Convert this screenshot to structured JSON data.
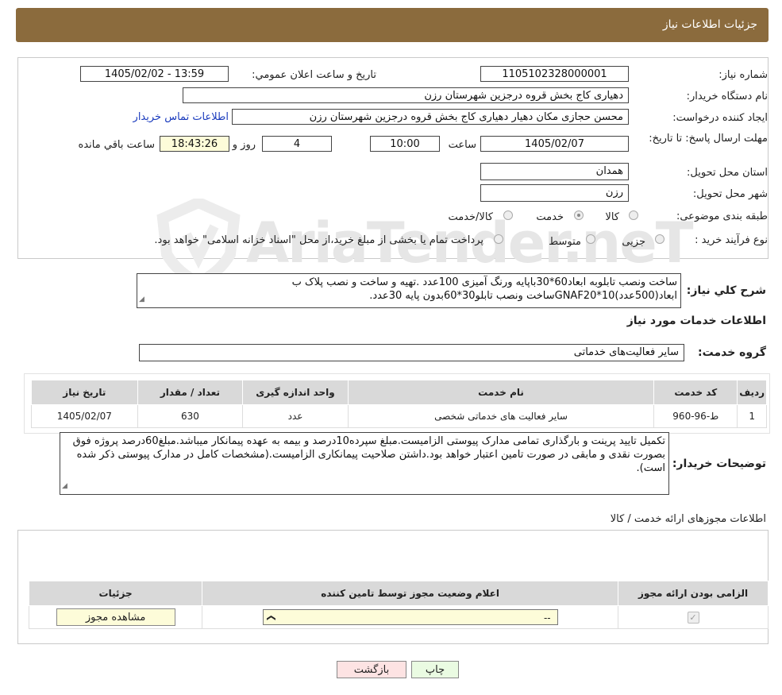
{
  "header": {
    "title": "جزئیات اطلاعات نیاز"
  },
  "fields": {
    "need_number_label": "شماره نیاز:",
    "need_number": "1105102328000001",
    "announce_label": "تاريخ و ساعت اعلان عمومي:",
    "announce_value": "1405/02/02 - 13:59",
    "buyer_org_label": "نام دستگاه خریدار:",
    "buyer_org": "دهیاری کاج بخش قروه درجزین شهرستان رزن",
    "creator_label": "ایجاد کننده درخواست:",
    "creator": "محسن حجازی مکان دهیار دهیاری کاج بخش قروه درجزین شهرستان رزن",
    "contact_link": "اطلاعات تماس خریدار",
    "deadline_label": "مهلت ارسال پاسخ: تا تاریخ:",
    "deadline_date": "1405/02/07",
    "time_label": "ساعت",
    "deadline_time": "10:00",
    "days_value": "4",
    "days_label": "روز و",
    "remaining_time": "18:43:26",
    "remaining_label": "ساعت باقي مانده",
    "province_label": "استان محل تحویل:",
    "province": "همدان",
    "city_label": "شهر محل تحویل:",
    "city": "رزن",
    "category_label": "طبقه بندی موضوعی:",
    "category_options": [
      "کالا",
      "خدمت",
      "کالا/خدمت"
    ],
    "process_label": "نوع فرآیند خرید :",
    "process_options": [
      "جزیی",
      "متوسط"
    ],
    "process_note": "پرداخت تمام یا بخشی از مبلغ خرید،از محل \"اسناد خزانه اسلامی\" خواهد بود."
  },
  "summary": {
    "label": "شرح کلي نياز:",
    "text": "ساخت ونصب تابلوبه ابعاد60*30باپایه ورنگ آمیزی 100عدد .تهیه و ساخت و نصب پلاک ب ابعاد(500عدد)10*GNAF20ساخت ونصب تابلو30*60بدون پایه 30عدد."
  },
  "services": {
    "section_title": "اطلاعات خدمات مورد نياز",
    "group_label": "گروه خدمت:",
    "group_value": "سایر فعالیت‌های خدماتی",
    "columns": [
      "ردیف",
      "کد خدمت",
      "نام خدمت",
      "واحد اندازه گیری",
      "تعداد / مقدار",
      "تاریخ نیاز"
    ],
    "rows": [
      {
        "row": "1",
        "code": "ط-96-960",
        "name": "سایر فعالیت های خدماتی شخصی",
        "unit": "عدد",
        "qty": "630",
        "date": "1405/02/07"
      }
    ]
  },
  "buyer_notes": {
    "label": "توضیحات خریدار:",
    "text": "تکمیل تایید پرینت و بارگذاری تمامی مدارک پیوستی الزامیست.مبلغ سپرده10درصد و بیمه به عهده پیمانکار میباشد.مبلغ60درصد پروژه فوق بصورت نقدی و مابقی در صورت تامین اعتبار خواهد بود.داشتن صلاحیت پیمانکاری الزامیست.(مشخصات کامل در مدارک پیوستی ذکر شده است)."
  },
  "permits": {
    "section_title": "اطلاعات مجوزهای ارائه خدمت / کالا",
    "columns": [
      "الزامی بودن ارائه مجوز",
      "اعلام وضعیت مجوز توسط تامین کننده",
      "جزئیات"
    ],
    "select_value": "--",
    "view_button": "مشاهده مجوز"
  },
  "actions": {
    "print": "چاپ",
    "back": "بازگشت"
  },
  "watermark": "AriaTender.neT",
  "colors": {
    "header_bg": "#8b6b3d",
    "link": "#1a3bbd",
    "back_btn_bg": "#fde3e3",
    "print_btn_bg": "#eafbe2",
    "highlight": "#fdfcd9"
  }
}
